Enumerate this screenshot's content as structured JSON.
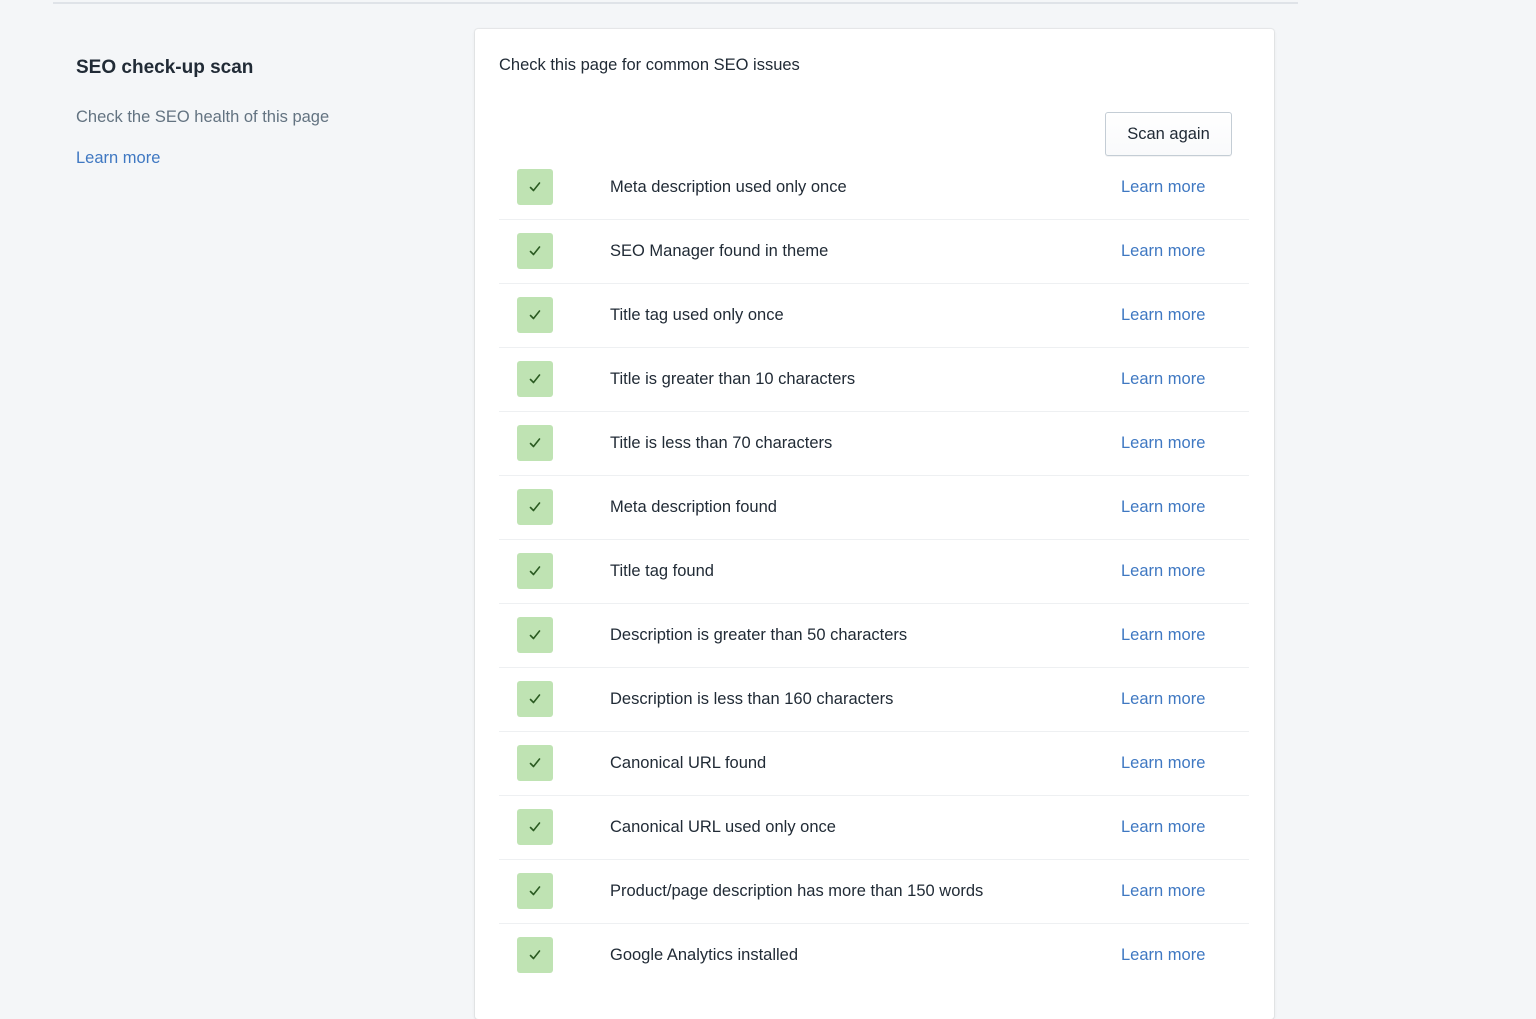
{
  "colors": {
    "page_background": "#f4f6f8",
    "card_background": "#ffffff",
    "link": "#3f78c2",
    "check_background": "#bfe3b3",
    "check_mark": "#2b5b22"
  },
  "sidebar": {
    "title": "SEO check-up scan",
    "description": "Check the SEO health of this page",
    "learn_more": "Learn more"
  },
  "card": {
    "heading": "Check this page for common SEO issues",
    "scan_button": "Scan again",
    "items": [
      {
        "label": "Meta description used only once",
        "status": "passed",
        "icon": "checkmark-icon",
        "link": "Learn more"
      },
      {
        "label": "SEO Manager found in theme",
        "status": "passed",
        "icon": "checkmark-icon",
        "link": "Learn more"
      },
      {
        "label": "Title tag used only once",
        "status": "passed",
        "icon": "checkmark-icon",
        "link": "Learn more"
      },
      {
        "label": "Title is greater than 10 characters",
        "status": "passed",
        "icon": "checkmark-icon",
        "link": "Learn more"
      },
      {
        "label": "Title is less than 70 characters",
        "status": "passed",
        "icon": "checkmark-icon",
        "link": "Learn more"
      },
      {
        "label": "Meta description found",
        "status": "passed",
        "icon": "checkmark-icon",
        "link": "Learn more"
      },
      {
        "label": "Title tag found",
        "status": "passed",
        "icon": "checkmark-icon",
        "link": "Learn more"
      },
      {
        "label": "Description is greater than 50 characters",
        "status": "passed",
        "icon": "checkmark-icon",
        "link": "Learn more"
      },
      {
        "label": "Description is less than 160 characters",
        "status": "passed",
        "icon": "checkmark-icon",
        "link": "Learn more"
      },
      {
        "label": "Canonical URL found",
        "status": "passed",
        "icon": "checkmark-icon",
        "link": "Learn more"
      },
      {
        "label": "Canonical URL used only once",
        "status": "passed",
        "icon": "checkmark-icon",
        "link": "Learn more"
      },
      {
        "label": "Product/page description has more than 150 words",
        "status": "passed",
        "icon": "checkmark-icon",
        "link": "Learn more"
      },
      {
        "label": "Google Analytics installed",
        "status": "passed",
        "icon": "checkmark-icon",
        "link": "Learn more"
      }
    ]
  }
}
